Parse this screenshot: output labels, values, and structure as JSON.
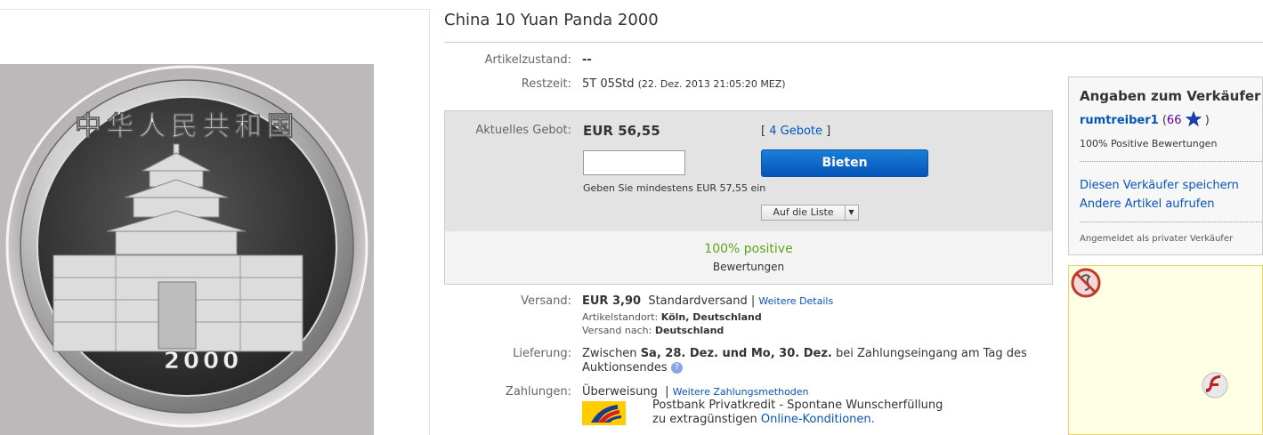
{
  "listing": {
    "title": "China 10 Yuan Panda 2000",
    "coin_inscription": "中华人民共和国",
    "coin_year": "2000"
  },
  "details": {
    "condition_label": "Artikelzustand:",
    "condition_value": "--",
    "time_left_label": "Restzeit:",
    "time_left_value": "5T 05Std",
    "time_left_end": "(22. Dez. 2013  21:05:20 MEZ)"
  },
  "bid": {
    "current_label": "Aktuelles Gebot:",
    "current_value": "EUR 56,55",
    "bids_open": "[",
    "bids_link": "4 Gebote",
    "bids_close": "]",
    "input_value": "",
    "button_label": "Bieten",
    "min_hint": "Geben Sie mindestens EUR 57,55 ein",
    "watch_label": "Auf die Liste",
    "watch_arrow": "▼",
    "positive": "100% positive",
    "ratings": "Bewertungen"
  },
  "shipping": {
    "label": "Versand:",
    "cost": "EUR 3,90",
    "method": "Standardversand |",
    "details_link": "Weitere Details",
    "location_label": "Artikelstandort:",
    "location_value": "Köln, Deutschland",
    "ships_to_label": "Versand nach:",
    "ships_to_value": "Deutschland"
  },
  "delivery": {
    "label": "Lieferung:",
    "text_1": "Zwischen",
    "dates": "Sa, 28. Dez. und Mo, 30. Dez.",
    "text_2": "bei Zahlungseingang am Tag des",
    "text_3": "Auktionsendes",
    "help_icon": "?"
  },
  "payment": {
    "label": "Zahlungen:",
    "method": "Überweisung",
    "separator": "|",
    "more_link": "Weitere Zahlungsmethoden",
    "credit_line_1": "Postbank Privatkredit - Spontane Wunscherfüllung",
    "credit_line_2": "zu extragünstigen",
    "credit_link": "Online-Konditionen."
  },
  "seller": {
    "heading": "Angaben zum Verkäufer",
    "name": "rumtreiber1",
    "score_open": "(",
    "score": "66",
    "score_close": ")",
    "positive": "100% Positive Bewertungen",
    "save_link": "Diesen Verkäufer speichern",
    "other_link": "Andere Artikel aufrufen",
    "account_type": "Angemeldet als privater Verkäufer"
  },
  "colors": {
    "accent_blue": "#0654ba",
    "positive_green": "#5ba71b",
    "star_blue": "#1b3fb8",
    "seller_score_purple": "#660099"
  },
  "icons": {
    "star": "star-icon",
    "help": "help-icon",
    "flash_blocked": "blocked-plugin-icon",
    "flash": "flash-icon"
  }
}
